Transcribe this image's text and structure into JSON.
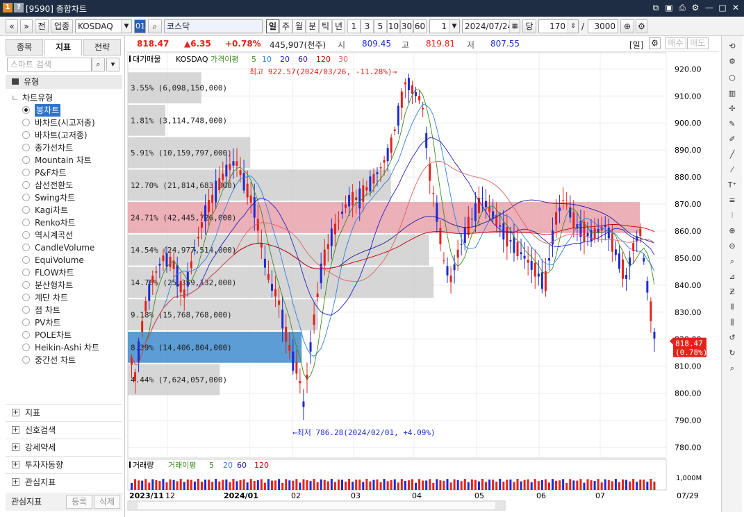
{
  "window": {
    "title": "[9590] 종합차트",
    "icon1": "1",
    "icon2": "?"
  },
  "toolbar": {
    "nav_prev": "«",
    "nav_down": "»",
    "jeon": "전",
    "category": "업종",
    "market": "KOSDAQ",
    "code": "01",
    "search_icon": "⌕",
    "name": "코스닥",
    "periods": [
      "일",
      "주",
      "월",
      "분",
      "틱",
      "년"
    ],
    "numbers": [
      "1",
      "3",
      "5",
      "10",
      "30",
      "60"
    ],
    "interval": "1",
    "date": "2024/07/24",
    "dang": "당",
    "count": "170",
    "slash": "/",
    "total": "3000"
  },
  "left": {
    "tabs": [
      "종목",
      "지표",
      "전략"
    ],
    "search_placeholder": "스마트 검색",
    "type_header": "유형",
    "chart_type_label": "차트유형",
    "chart_types": [
      "봉차트",
      "바차트(시고저종)",
      "바차트(고저종)",
      "종가선차트",
      "Mountain 차트",
      "P&F차트",
      "삼선전환도",
      "Swing차트",
      "Kagi차트",
      "Renko차트",
      "역시계곡선",
      "CandleVolume",
      "EquiVolume",
      "FLOW차트",
      "분산형차트",
      "계단 차트",
      "점 차트",
      "PV차트",
      "POLE차트",
      "Heikin-Ashi 차트",
      "중간선 차트"
    ],
    "sections": [
      "지표",
      "신호검색",
      "강세약세",
      "투자자동향",
      "관심지표"
    ],
    "bottom_label": "관심지표",
    "register": "등록",
    "delete": "삭제"
  },
  "price": {
    "current": "818.47",
    "change": "▲6.35",
    "pct": "+0.78%",
    "volume": "445,907(천주)",
    "open_label": "시",
    "open": "809.45",
    "high_label": "고",
    "high": "819.81",
    "low_label": "저",
    "low": "807.55",
    "period": "[일]",
    "buy": "매수",
    "sell": "매도"
  },
  "legend": {
    "vp": "대기매물",
    "idx": "KOSDAQ",
    "ma_label": "가격이평",
    "ma": [
      "5",
      "10",
      "20",
      "60",
      "120",
      "30"
    ],
    "vol": "거래량",
    "vma_label": "거래이평",
    "vma": [
      "5",
      "20",
      "60",
      "120"
    ]
  },
  "colors": {
    "up": "#e2231a",
    "down": "#1c2bd1",
    "accent": "#ff0000"
  },
  "chart_data": {
    "type": "candlestick",
    "title": "KOSDAQ",
    "y_ticks": [
      "920.00",
      "910.00",
      "900.00",
      "890.00",
      "880.00",
      "870.00",
      "860.00",
      "850.00",
      "840.00",
      "830.00",
      "820.00",
      "810.00",
      "800.00",
      "790.00",
      "780.00"
    ],
    "ylim": [
      776,
      926
    ],
    "x_labels": [
      "2023/11",
      "12",
      "2024/01",
      "02",
      "03",
      "04",
      "05",
      "06",
      "07",
      "07/29"
    ],
    "annot_high": "최고 922.57(2024/03/26, -11.28%)→",
    "annot_low": "←최저 786.28(2024/02/01, +4.09%)",
    "current_tag": "818.47",
    "current_pct": "(0.78%)",
    "vol_axis": "1,000M",
    "volume_profile": [
      {
        "from": 907,
        "to": 919,
        "label": "3.55% (6,098,150,000)"
      },
      {
        "from": 895,
        "to": 907,
        "label": "1.81% (3,114,748,000)"
      },
      {
        "from": 883,
        "to": 895,
        "label": "5.91% (10,159,797,000)"
      },
      {
        "from": 871,
        "to": 883,
        "label": "12.70% (21,814,683,000)"
      },
      {
        "from": 859,
        "to": 871,
        "label": "24.71% (42,445,726,000)"
      },
      {
        "from": 847,
        "to": 859,
        "label": "14.54% (24,977,514,000)"
      },
      {
        "from": 835,
        "to": 847,
        "label": "14.76% (25,359,132,000)"
      },
      {
        "from": 823,
        "to": 835,
        "label": "9.18% (15,768,768,000)"
      },
      {
        "from": 811,
        "to": 823,
        "label": "8.39% (14,406,804,000)"
      },
      {
        "from": 799,
        "to": 811,
        "label": "4.44% (7,624,057,000)"
      }
    ]
  }
}
